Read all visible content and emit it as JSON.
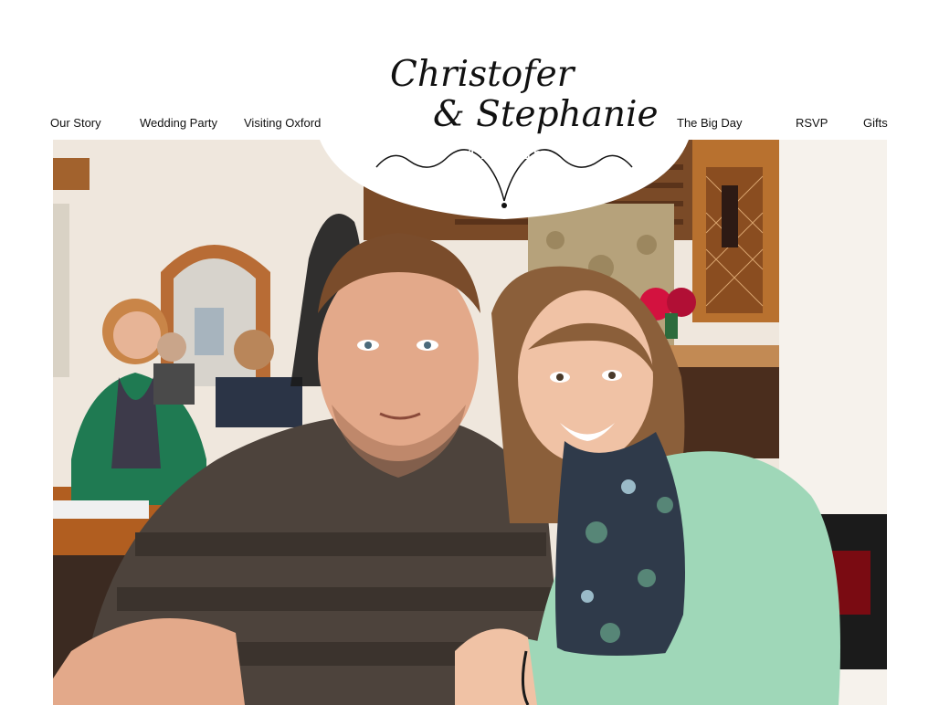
{
  "header": {
    "names_line1": "Christofer",
    "names_line2": "& Stephanie",
    "date": "4.18.2015"
  },
  "nav": {
    "our_story": "Our Story",
    "wedding_party": "Wedding Party",
    "visiting_oxford": "Visiting Oxford",
    "the_big_day": "The Big Day",
    "rsvp": "RSVP",
    "gifts": "Gifts"
  },
  "hero": {
    "alt": "Couple photo in a restaurant",
    "colors": {
      "wall": "#efe7dd",
      "wood": "#b8712f",
      "floor_dark": "#3b2a21",
      "mans_shirt": "#4d433c",
      "woman_cardigan": "#9fd7b8",
      "scarf": "#2f3a4a",
      "woman_hair": "#8b5f3a",
      "skin": "#e8b391"
    }
  }
}
